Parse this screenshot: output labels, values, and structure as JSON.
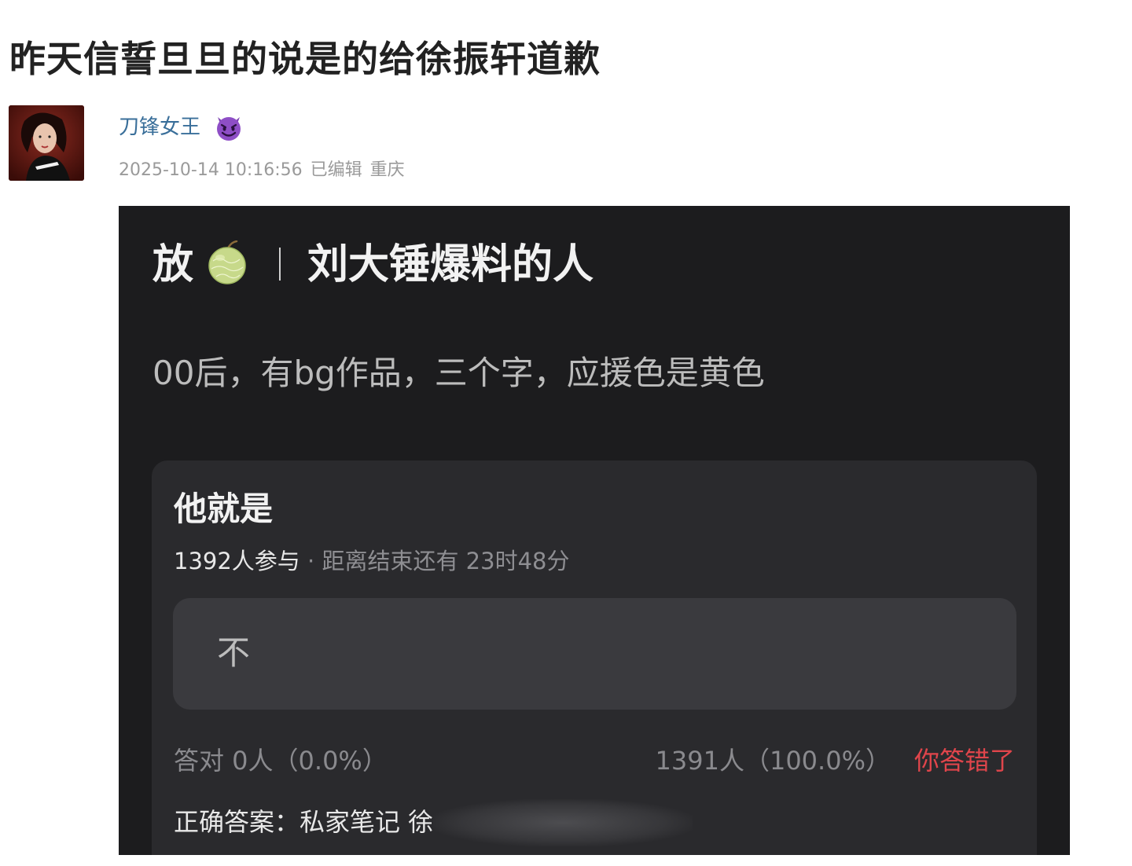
{
  "post": {
    "title": "昨天信誓旦旦的说是的给徐振轩道歉",
    "author": {
      "name": "刀锋女王",
      "emoji": "smiling-devil-emoji"
    },
    "timestamp": "2025-10-14 10:16:56",
    "edited": "已编辑",
    "location": "重庆"
  },
  "embed": {
    "title_left": "放",
    "title_icon": "melon-icon",
    "title_right": "刘大锤爆料的人",
    "description": "00后，有bg作品，三个字，应援色是黄色",
    "quiz": {
      "question": "他就是",
      "participants": "1392人参与",
      "separator": "·",
      "time_left": "距离结束还有 23时48分",
      "option": "不",
      "correct_stat": "答对  0人（0.0%）",
      "option_stat": "1391人（100.0%）",
      "status": "你答错了",
      "answer": "正确答案：私家笔记 徐"
    }
  },
  "colors": {
    "author_link": "#3a6f9a",
    "wrong": "#e0454b",
    "embed_bg": "#1c1c1e",
    "card_bg": "#2a2a2d"
  }
}
